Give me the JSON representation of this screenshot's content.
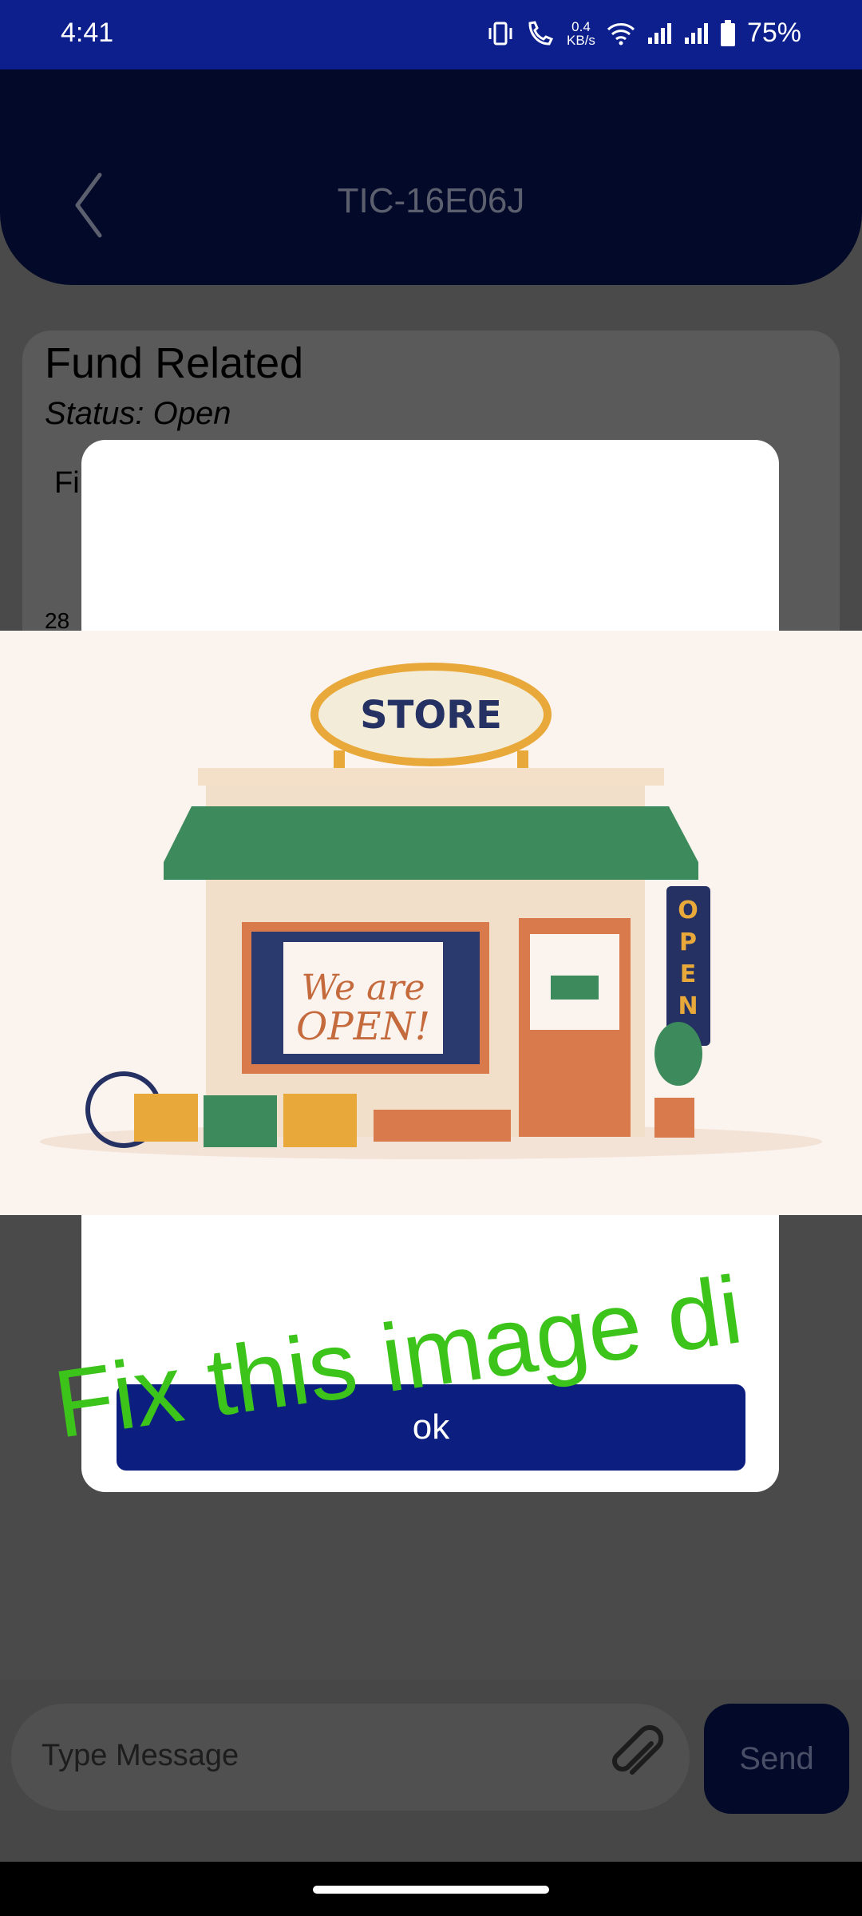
{
  "status_bar": {
    "time": "4:41",
    "net_speed_value": "0.4",
    "net_speed_unit": "KB/s",
    "battery": "75%",
    "icons": [
      "vibrate-icon",
      "call-icon",
      "wifi-icon",
      "signal-icon",
      "signal-icon",
      "battery-icon"
    ]
  },
  "header": {
    "title": "TIC-16E06J",
    "back_icon": "chevron-left-icon"
  },
  "ticket": {
    "title": "Fund Related",
    "status": "Status: Open",
    "body_partial": "Fi",
    "date_partial": "28"
  },
  "dialog": {
    "image_caption_text": [
      "STORE",
      "We are OPEN!",
      "OPEN"
    ],
    "ok_label": "ok"
  },
  "overlay": {
    "text": "Fix this image di"
  },
  "composer": {
    "placeholder": "Type Message",
    "attach_icon": "paperclip-icon",
    "send_label": "Send"
  },
  "colors": {
    "status_bar": "#0c1f8c",
    "header": "#030928",
    "dim_background": "#4a4a4a",
    "ok_button": "#0c1f80",
    "overlay_text": "#3cc41a"
  }
}
